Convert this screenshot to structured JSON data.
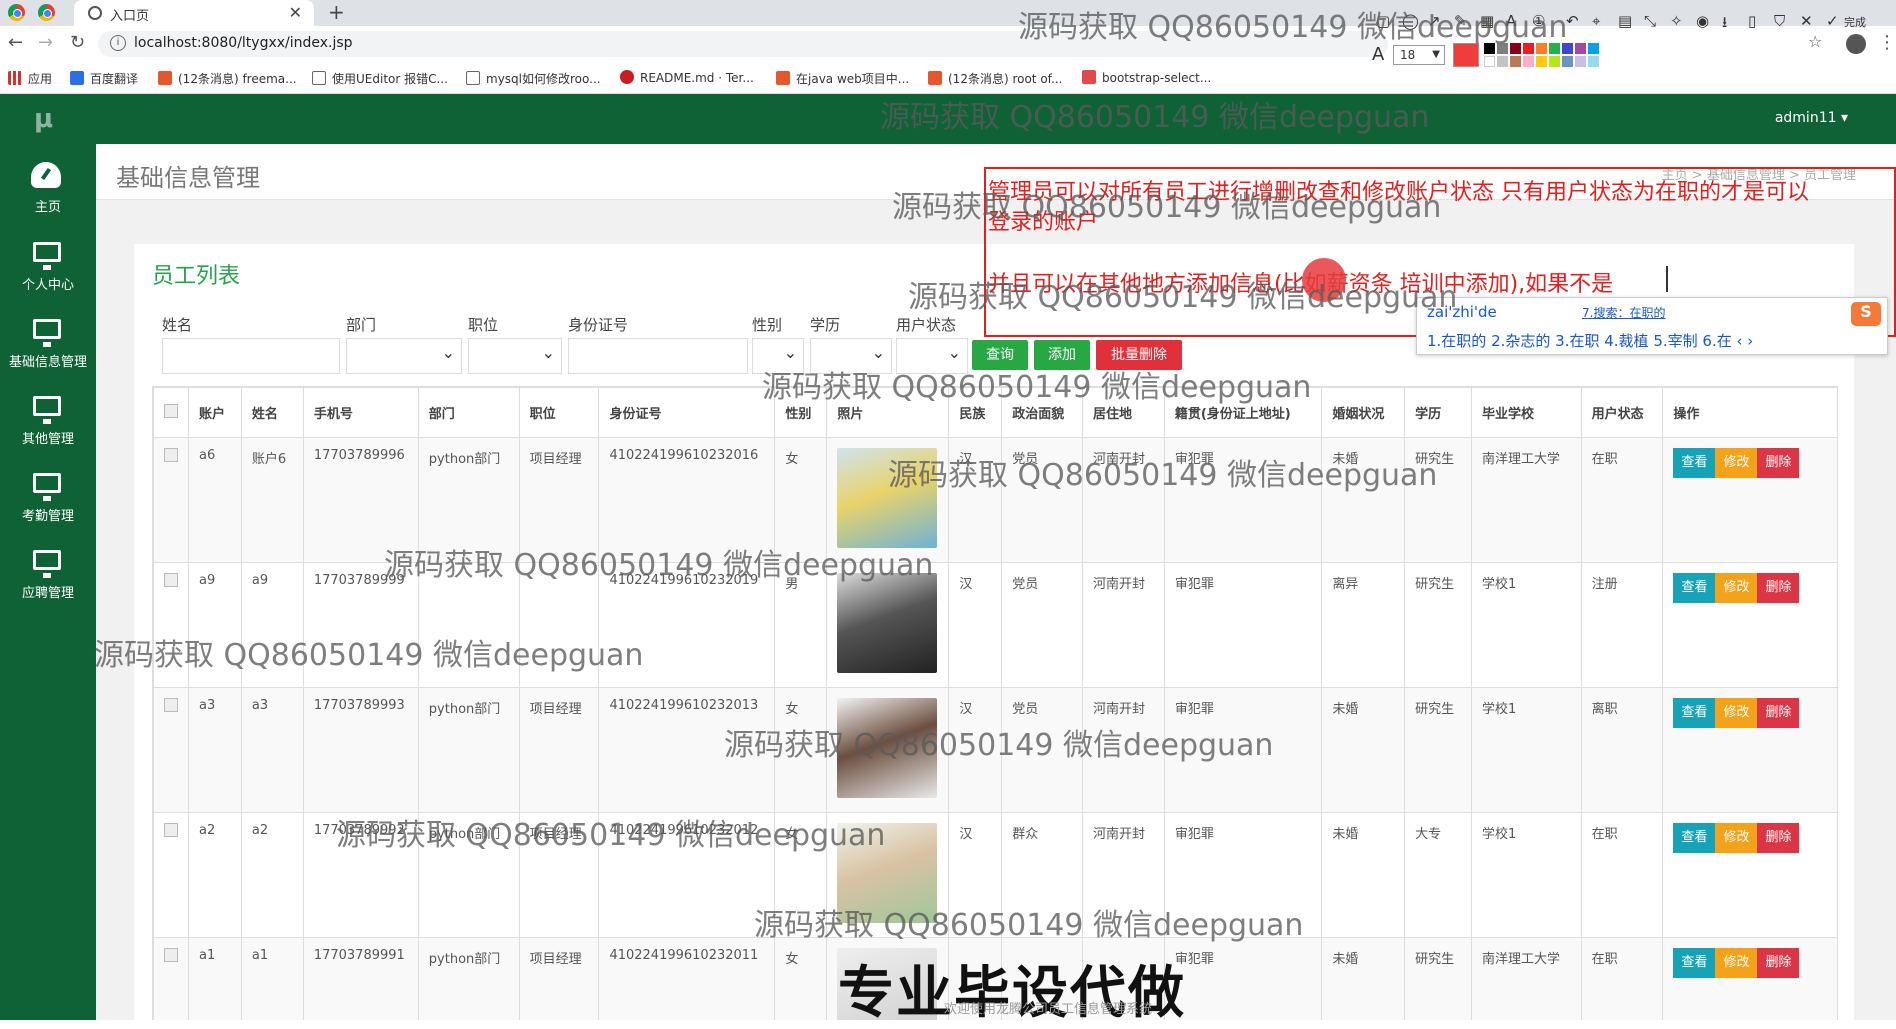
{
  "browser": {
    "tab_title": "入口页",
    "url": "localhost:8080/ltygxx/index.jsp",
    "bookmarks": [
      "应用",
      "百度翻译",
      "(12条消息) freema...",
      "使用UEditor 报错C...",
      "mysql如何修改roo...",
      "README.md · Ter...",
      "在java web项目中...",
      "(12条消息) root of...",
      "bootstrap-select..."
    ]
  },
  "snap_toolbar": {
    "font_size": "18"
  },
  "app": {
    "logo": "μ",
    "user": "admin11 ▾",
    "sidebar": [
      {
        "label": "主页",
        "icon": "dashboard-icon"
      },
      {
        "label": "个人中心",
        "icon": "monitor-icon"
      },
      {
        "label": "基础信息管理",
        "icon": "monitor-icon"
      },
      {
        "label": "其他管理",
        "icon": "monitor-icon"
      },
      {
        "label": "考勤管理",
        "icon": "monitor-icon"
      },
      {
        "label": "应聘管理",
        "icon": "monitor-icon"
      }
    ],
    "page_title": "基础信息管理",
    "breadcrumb": "主页 > 基础信息管理 > 员工管理",
    "panel_title": "员工列表",
    "filters": {
      "name": "姓名",
      "dept": "部门",
      "position": "职位",
      "idcard": "身份证号",
      "gender": "性别",
      "education": "学历",
      "status": "用户状态"
    },
    "buttons": {
      "search": "查询",
      "add": "添加",
      "batch_delete": "批量删除"
    },
    "table": {
      "headers": [
        "账户",
        "姓名",
        "手机号",
        "部门",
        "职位",
        "身份证号",
        "性别",
        "照片",
        "民族",
        "政治面貌",
        "居住地",
        "籍贯(身份证上地址)",
        "婚姻状况",
        "学历",
        "毕业学校",
        "用户状态",
        "操作"
      ],
      "rows": [
        [
          "a6",
          "账户6",
          "17703789996",
          "python部门",
          "项目经理",
          "410224199610232016",
          "女",
          "",
          "汉",
          "党员",
          "河南开封",
          "审犯罪",
          "未婚",
          "研究生",
          "南洋理工大学",
          "在职"
        ],
        [
          "a9",
          "a9",
          "17703789999",
          "",
          "",
          "410224199610232019",
          "男",
          "",
          "汉",
          "党员",
          "河南开封",
          "审犯罪",
          "离异",
          "研究生",
          "学校1",
          "注册"
        ],
        [
          "a3",
          "a3",
          "17703789993",
          "python部门",
          "项目经理",
          "410224199610232013",
          "女",
          "",
          "汉",
          "党员",
          "河南开封",
          "审犯罪",
          "未婚",
          "研究生",
          "学校1",
          "离职"
        ],
        [
          "a2",
          "a2",
          "17703789992",
          "python部门",
          "项目经理",
          "410224199610232012",
          "女",
          "",
          "汉",
          "群众",
          "河南开封",
          "审犯罪",
          "未婚",
          "大专",
          "学校1",
          "在职"
        ],
        [
          "a1",
          "a1",
          "17703789991",
          "python部门",
          "项目经理",
          "410224199610232011",
          "女",
          "",
          "",
          "",
          "",
          "审犯罪",
          "未婚",
          "研究生",
          "南洋理工大学",
          "在职"
        ]
      ],
      "actions": {
        "view": "查看",
        "edit": "修改",
        "delete": "删除"
      }
    }
  },
  "annotation": {
    "line1": "管理员可以对所有员工进行增删改查和修改账户状态  只有用户状态为在职的才是可以",
    "line2": "登录的账户",
    "line3": "并且可以在其他地方添加信息(比如薪资条 培训中添加),如果不是"
  },
  "ime": {
    "composition": "zai'zhi'de",
    "search": "7.搜索：在职的",
    "candidates": "1.在职的   2.杂志的   3.在职   4.裁植   5.宰制   6.在   ‹ ›"
  },
  "watermark": "源码获取 QQ86050149 微信deepguan",
  "big_watermark": "专业毕设代做",
  "footer": "欢迎使用龙腾公司员工信息管理系统"
}
